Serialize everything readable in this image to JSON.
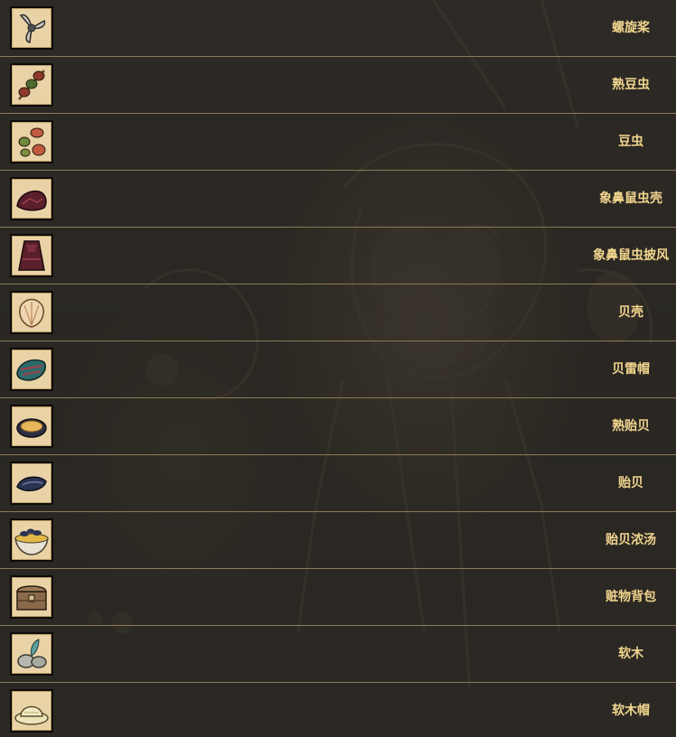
{
  "items": [
    {
      "label": "螺旋桨",
      "icon": "propeller-icon"
    },
    {
      "label": "熟豆虫",
      "icon": "cooked-bean-bug-icon"
    },
    {
      "label": "豆虫",
      "icon": "bean-bug-icon"
    },
    {
      "label": "象鼻鼠虫壳",
      "icon": "shell-piece-icon"
    },
    {
      "label": "象鼻鼠虫披风",
      "icon": "cloak-icon"
    },
    {
      "label": "贝壳",
      "icon": "seashell-icon"
    },
    {
      "label": "贝雷帽",
      "icon": "beret-icon"
    },
    {
      "label": "熟贻贝",
      "icon": "cooked-mussel-icon"
    },
    {
      "label": "贻贝",
      "icon": "mussel-icon"
    },
    {
      "label": "贻贝浓汤",
      "icon": "mussel-soup-icon"
    },
    {
      "label": "赃物背包",
      "icon": "treasure-chest-icon"
    },
    {
      "label": "软木",
      "icon": "cork-icon"
    },
    {
      "label": "软木帽",
      "icon": "cork-hat-icon"
    }
  ],
  "colors": {
    "background": "#2b2823",
    "divider": "#8a7a55",
    "label_text": "#f1d58e",
    "icon_tile": "#e9d3a6"
  }
}
